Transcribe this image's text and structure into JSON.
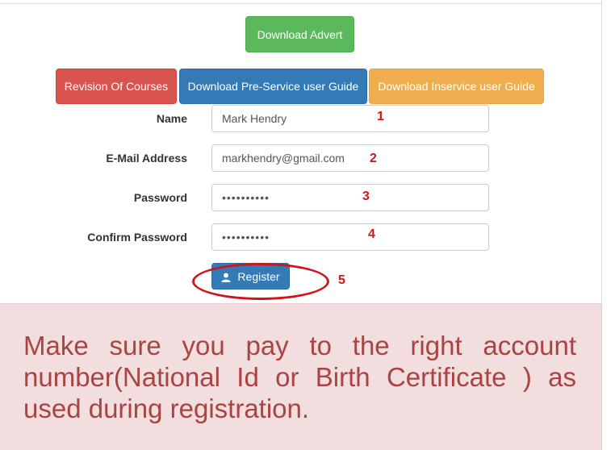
{
  "buttons": {
    "advert": "Download Advert",
    "revision": "Revision Of Courses",
    "preservice": "Download Pre-Service user Guide",
    "inservice": "Download Inservice user Guide",
    "register": "Register"
  },
  "form": {
    "name_label": "Name",
    "name_value": "Mark Hendry",
    "email_label": "E-Mail Address",
    "email_value": "markhendry@gmail.com",
    "password_label": "Password",
    "password_value": "••••••••••",
    "confirm_label": "Confirm Password",
    "confirm_value": "••••••••••"
  },
  "annotations": {
    "n1": "1",
    "n2": "2",
    "n3": "3",
    "n4": "4",
    "n5": "5"
  },
  "notice": {
    "text": "Make sure you pay to the right account number(National Id or Birth Certificate ) as used during registration."
  },
  "colors": {
    "success": "#5cb85c",
    "danger": "#d9534f",
    "primary": "#337ab7",
    "warning": "#f0ad4e",
    "annotation_red": "#d0141b",
    "notice_bg": "#f2dede",
    "notice_text": "#a94442"
  },
  "icons": {
    "register": "user-icon"
  }
}
